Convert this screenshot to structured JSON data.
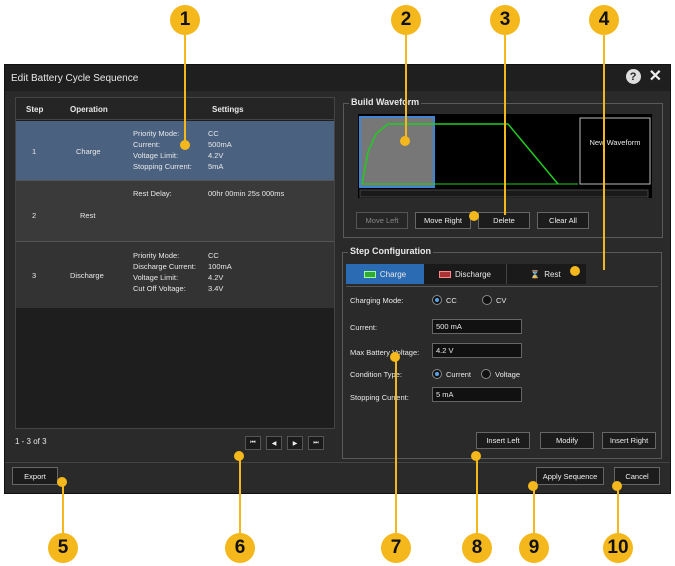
{
  "window": {
    "title": "Edit Battery Cycle Sequence"
  },
  "table": {
    "headers": {
      "step": "Step",
      "operation": "Operation",
      "settings": "Settings"
    },
    "rows": [
      {
        "step": "1",
        "operation": "Charge",
        "settings": [
          [
            "Priority Mode:",
            "CC"
          ],
          [
            "Current:",
            "500mA"
          ],
          [
            "Voltage Limit:",
            "4.2V"
          ],
          [
            "Stopping Current:",
            "5mA"
          ]
        ]
      },
      {
        "step": "2",
        "operation": "Rest",
        "settings": [
          [
            "Rest Delay:",
            "00hr 00min 25s 000ms"
          ]
        ]
      },
      {
        "step": "3",
        "operation": "Discharge",
        "settings": [
          [
            "Priority Mode:",
            "CC"
          ],
          [
            "Discharge Current:",
            "100mA"
          ],
          [
            "Voltage Limit:",
            "4.2V"
          ],
          [
            "Cut Off Voltage:",
            "3.4V"
          ]
        ]
      }
    ],
    "pager_text": "1 - 3 of 3"
  },
  "build": {
    "title": "Build Waveform",
    "new_waveform": "New Waveform",
    "buttons": {
      "move_left": "Move Left",
      "move_right": "Move Right",
      "delete": "Delete",
      "clear_all": "Clear All"
    }
  },
  "step_config": {
    "title": "Step Configuration",
    "tabs": {
      "charge": "Charge",
      "discharge": "Discharge",
      "rest": "Rest"
    },
    "charging_mode_label": "Charging Mode:",
    "mode_cc": "CC",
    "mode_cv": "CV",
    "current_label": "Current:",
    "current_value": "500 mA",
    "max_voltage_label": "Max Battery Voltage:",
    "max_voltage_value": "4.2 V",
    "condition_label": "Condition Type:",
    "cond_current": "Current",
    "cond_voltage": "Voltage",
    "stopping_label": "Stopping Current:",
    "stopping_value": "5 mA",
    "buttons": {
      "insert_left": "Insert Left",
      "modify": "Modify",
      "insert_right": "Insert Right"
    }
  },
  "footer": {
    "export": "Export",
    "apply": "Apply Sequence",
    "cancel": "Cancel"
  },
  "callouts": [
    "1",
    "2",
    "3",
    "4",
    "5",
    "6",
    "7",
    "8",
    "9",
    "10"
  ],
  "colors": {
    "accent_blue": "#2b6bb3",
    "wave_green": "#22cc22",
    "callout": "#f5b81c",
    "row_selected": "#4a6280"
  }
}
